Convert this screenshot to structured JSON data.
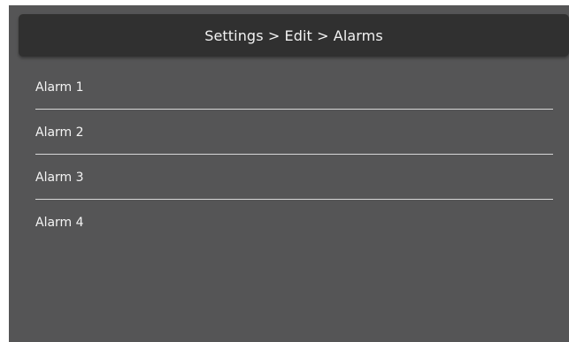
{
  "header": {
    "title": "Settings > Edit > Alarms"
  },
  "alarms": [
    {
      "label": "Alarm 1"
    },
    {
      "label": "Alarm 2"
    },
    {
      "label": "Alarm 3"
    },
    {
      "label": "Alarm 4"
    }
  ],
  "colors": {
    "panel_background": "#555556",
    "header_background": "#303030",
    "text": "#f4f4f4",
    "divider": "#d8d8d8"
  }
}
